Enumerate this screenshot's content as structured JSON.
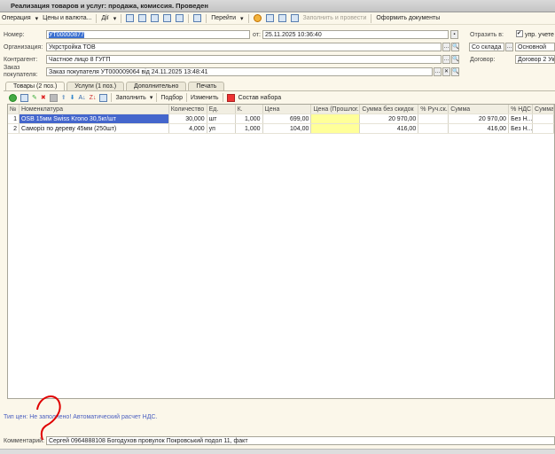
{
  "window": {
    "title": "Реализация товаров и услуг: продажа, комиссия. Проведен"
  },
  "toolbar": {
    "operation": "Операция",
    "prices": "Цены и валюта...",
    "actions": "Дії",
    "goto": "Перейти",
    "fill_post": "Заполнить и провести",
    "make_docs": "Оформить документы"
  },
  "form": {
    "number_label": "Номер:",
    "number": "УТ00000877",
    "date_label": "от:",
    "date": "25.11.2025 10:36:40",
    "org_label": "Организация:",
    "org": "Укрстройка ТОВ",
    "contractor_label": "Контрагент:",
    "contractor": "Частное лицо 8 ГУГП",
    "order_label": "Заказ покупателя:",
    "order": "Заказ покупателя УТ000009064 від 24.11.2025 13:48:41",
    "reflect_label": "Отразить в:",
    "mgmt_check": "упр. учете",
    "mgmt_checked": true,
    "from_wh": "Со склада",
    "warehouse": "Основной",
    "contract_label": "Договор:",
    "contract": "Договор 2 Укр"
  },
  "tabs": [
    {
      "label": "Товары (2 поз.)",
      "active": true
    },
    {
      "label": "Услуги (1 поз.)"
    },
    {
      "label": "Дополнительно"
    },
    {
      "label": "Печать"
    }
  ],
  "table_toolbar": {
    "fill": "Заполнить",
    "select": "Подбор",
    "change": "Изменить",
    "set": "Состав набора"
  },
  "table": {
    "columns": [
      "№",
      "Номенклатура",
      "Количество",
      "Ед.",
      "К.",
      "Цена",
      "Цена (Прошлог...",
      "Сумма без скидок",
      "% Руч.ск.",
      "Сумма",
      "% НДС",
      "Сумма"
    ],
    "rows": [
      [
        "1",
        "OSB  15мм Swiss Krono 30,5кг/шт",
        "30,000",
        "шт",
        "1,000",
        "699,00",
        "",
        "20 970,00",
        "",
        "20 970,00",
        "Без Н...",
        ""
      ],
      [
        "2",
        "Саморіз по дереву 45мм (250шт)",
        "4,000",
        "уп",
        "1,000",
        "104,00",
        "",
        "416,00",
        "",
        "416,00",
        "Без Н...",
        ""
      ]
    ]
  },
  "footer": {
    "price_type": "Тип цен: Не заполнено! Автоматический расчет НДС.",
    "comment_label": "Комментарий:",
    "comment": "Сергей 0964888108 Богодухов провулок Покровський подол 11, факт"
  },
  "colors": {
    "selection": "#4466cc",
    "highlight": "#ffff99",
    "annotation": "#e00000"
  }
}
